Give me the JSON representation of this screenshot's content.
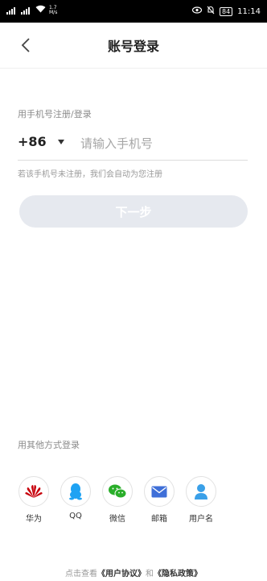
{
  "status_bar": {
    "net_top": "1.7",
    "net_bottom": "M/s",
    "battery": "84",
    "time": "11:14"
  },
  "nav": {
    "title": "账号登录"
  },
  "form": {
    "section_label": "用手机号注册/登录",
    "country_code": "+86",
    "phone_placeholder": "请输入手机号",
    "phone_value": "",
    "note": "若该手机号未注册，我们会自动为您注册",
    "next_button": "下一步"
  },
  "other_login": {
    "label": "用其他方式登录",
    "methods": [
      {
        "label": "华为",
        "icon": "huawei-icon",
        "color": "#c7000b"
      },
      {
        "label": "QQ",
        "icon": "qq-icon",
        "color": "#1ea2f3"
      },
      {
        "label": "微信",
        "icon": "wechat-icon",
        "color": "#2aae2a"
      },
      {
        "label": "邮箱",
        "icon": "mail-icon",
        "color": "#3f6fd8"
      },
      {
        "label": "用户名",
        "icon": "user-icon",
        "color": "#3aa0e8"
      }
    ]
  },
  "footer": {
    "prefix": "点击查看",
    "user_agreement": "《用户协议》",
    "and": "和",
    "privacy_policy": "《隐私政策》"
  }
}
